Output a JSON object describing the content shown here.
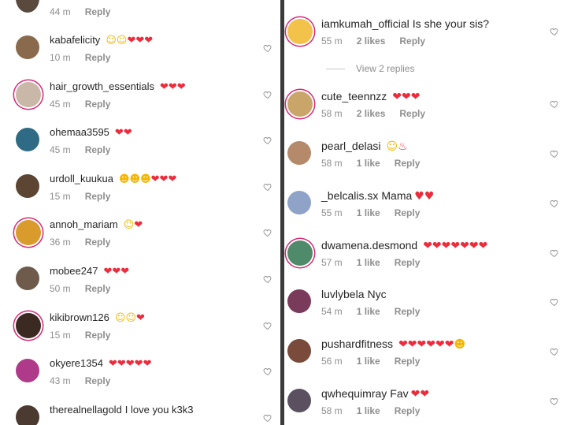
{
  "left": {
    "top_row": {
      "time": "44 m",
      "reply": "Reply"
    },
    "comments": [
      {
        "user": "kabafelicity",
        "text": "",
        "emoji": [
          "laugh",
          "laugh",
          "heart",
          "heart",
          "heart"
        ],
        "time": "10 m",
        "reply": "Reply",
        "ring": false,
        "avatar_color": "#8a6a4c"
      },
      {
        "user": "hair_growth_essentials",
        "text": "",
        "emoji": [
          "heart",
          "heart",
          "heart"
        ],
        "time": "45 m",
        "reply": "Reply",
        "ring": true,
        "avatar_color": "#c9b8a8"
      },
      {
        "user": "ohemaa3595",
        "text": "",
        "emoji": [
          "heart",
          "heart"
        ],
        "time": "45 m",
        "reply": "Reply",
        "ring": false,
        "avatar_color": "#2f6b84"
      },
      {
        "user": "urdoll_kuukua",
        "text": "",
        "emoji": [
          "heart-eyes",
          "heart-eyes",
          "heart-eyes",
          "heart",
          "heart",
          "heart"
        ],
        "time": "15 m",
        "reply": "Reply",
        "ring": false,
        "avatar_color": "#5c4533"
      },
      {
        "user": "annoh_mariam",
        "text": "",
        "emoji": [
          "laugh",
          "heart"
        ],
        "time": "36 m",
        "reply": "Reply",
        "ring": true,
        "avatar_color": "#d99b2b"
      },
      {
        "user": "mobee247",
        "text": "",
        "emoji": [
          "heart",
          "heart",
          "heart"
        ],
        "time": "50 m",
        "reply": "Reply",
        "ring": false,
        "avatar_color": "#6e5b4c"
      },
      {
        "user": "kikibrown126",
        "text": "",
        "emoji": [
          "laugh",
          "laugh",
          "heart"
        ],
        "time": "15 m",
        "reply": "Reply",
        "ring": true,
        "avatar_color": "#3b2a22"
      },
      {
        "user": "okyere1354",
        "text": "",
        "emoji": [
          "heart",
          "heart",
          "heart",
          "heart",
          "heart"
        ],
        "time": "43 m",
        "reply": "Reply",
        "ring": false,
        "avatar_color": "#b03a8a"
      },
      {
        "user": "therealnellagold",
        "text": "I love you k3k3",
        "emoji": [],
        "time": "",
        "reply": "",
        "ring": false,
        "avatar_color": "#4a3a30"
      }
    ]
  },
  "right": {
    "comments": [
      {
        "user": "iamkumah_official",
        "text": "Is she your sis?",
        "emoji": [],
        "time": "55 m",
        "likes": "2 likes",
        "reply": "Reply",
        "ring": true,
        "avatar_color": "#f3c24a"
      },
      {
        "user": "cute_teennzz",
        "text": "",
        "emoji": [
          "heart",
          "heart",
          "heart"
        ],
        "time": "58 m",
        "likes": "2 likes",
        "reply": "Reply",
        "ring": true,
        "avatar_color": "#c9a56a"
      },
      {
        "user": "pearl_delasi",
        "text": "",
        "emoji": [
          "laugh",
          "fire"
        ],
        "time": "58 m",
        "likes": "1 like",
        "reply": "Reply",
        "ring": false,
        "avatar_color": "#b58a6a"
      },
      {
        "user": "_belcalis.sx",
        "text": "Mama",
        "emoji": [
          "sparkle-heart",
          "sparkle-heart"
        ],
        "time": "55 m",
        "likes": "1 like",
        "reply": "Reply",
        "ring": false,
        "avatar_color": "#8fa3c8"
      },
      {
        "user": "dwamena.desmond",
        "text": "",
        "emoji": [
          "heart",
          "heart",
          "heart",
          "heart",
          "heart",
          "heart",
          "heart"
        ],
        "time": "57 m",
        "likes": "1 like",
        "reply": "Reply",
        "ring": true,
        "avatar_color": "#4f8a6a"
      },
      {
        "user": "luvlybela",
        "text": "Nyc",
        "emoji": [],
        "time": "54 m",
        "likes": "1 like",
        "reply": "Reply",
        "ring": false,
        "avatar_color": "#7a3a5a"
      },
      {
        "user": "pushardfitness",
        "text": "",
        "emoji": [
          "heart",
          "heart",
          "heart",
          "heart",
          "heart",
          "heart",
          "heart-eyes"
        ],
        "time": "56 m",
        "likes": "1 like",
        "reply": "Reply",
        "ring": false,
        "avatar_color": "#7a4a3a"
      },
      {
        "user": "qwhequimray",
        "text": "Fav",
        "emoji": [
          "heart",
          "heart"
        ],
        "time": "58 m",
        "likes": "1 like",
        "reply": "Reply",
        "ring": false,
        "avatar_color": "#5a5060"
      }
    ],
    "view_replies": "View 2 replies"
  },
  "colors": {
    "ring": "#d62976",
    "heart": "#ed2b3b",
    "muted": "#8e8e8e",
    "text": "#262626"
  },
  "icons": {
    "like": "heart-outline-icon"
  }
}
